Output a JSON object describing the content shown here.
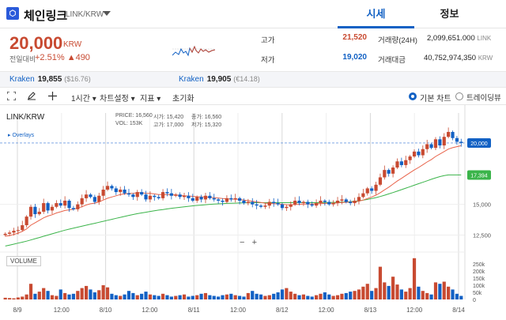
{
  "header": {
    "logo_glyph": "⬡",
    "coin_name": "체인링크",
    "pair": "LINK/KRW",
    "tab_quote": "시세",
    "tab_info": "정보"
  },
  "price": {
    "current": "20,000",
    "currency": "KRW",
    "change_label": "전일대비",
    "change_pct": "+2.51%",
    "change_abs": "▲490",
    "high_label": "고가",
    "high": "21,520",
    "low_label": "저가",
    "low": "19,020",
    "vol24_label": "거래량(24H)",
    "vol24": "2,099,651.000",
    "vol24_unit": "LINK",
    "amt_label": "거래대금",
    "amt": "40,752,974,350",
    "amt_unit": "KRW"
  },
  "exchanges": [
    {
      "name": "Kraken",
      "value": "19,855",
      "usd": "($16.76)"
    },
    {
      "name": "Kraken",
      "value": "19,905",
      "usd": "(€14.18)"
    }
  ],
  "toolbar": {
    "interval": "1시간",
    "chart_settings": "차트설정",
    "indicators": "지표",
    "reset": "초기화",
    "basic_chart": "기본 차트",
    "tradingview": "트레이딩뷰"
  },
  "ohlc": {
    "price_lbl": "PRICE:",
    "price": "16,560",
    "open_lbl": "시가:",
    "open": "15,420",
    "close_lbl": "종가:",
    "close": "16,560",
    "vol_lbl": "VOL:",
    "vol": "153K",
    "high_lbl": "고가:",
    "high": "17,000",
    "low_lbl": "저가:",
    "low": "15,320"
  },
  "chart_labels": {
    "pair": "LINK/KRW",
    "overlays": "Overlays",
    "volume": "VOLUME",
    "zoom_minus": "−",
    "zoom_plus": "+"
  },
  "colors": {
    "up": "#c84a31",
    "down": "#1261c4",
    "ma_short": "#e8634a",
    "ma_long": "#3bb44a"
  },
  "chart_data": {
    "type": "candlestick",
    "x_ticks": [
      "8/9",
      "12:00",
      "8/10",
      "12:00",
      "8/11",
      "12:00",
      "8/12",
      "12:00",
      "8/13",
      "12:00",
      "8/14"
    ],
    "y_ticks": [
      "20,000",
      "17,394",
      "15,000",
      "12,500"
    ],
    "ylim": [
      11500,
      21800
    ],
    "price_marker": "20,000",
    "ma_marker": "17,394",
    "vol_ticks": [
      "250k",
      "200k",
      "150k",
      "100k",
      "50k",
      "0"
    ],
    "closes": [
      12600,
      12700,
      12850,
      12900,
      13300,
      14000,
      14800,
      14200,
      14400,
      15100,
      14500,
      14800,
      15100,
      14900,
      15300,
      14700,
      14600,
      15000,
      15500,
      15800,
      15600,
      15200,
      15700,
      16200,
      16500,
      16300,
      16000,
      16200,
      15900,
      15800,
      15600,
      16000,
      15800,
      15400,
      15700,
      15600,
      15500,
      16000,
      15900,
      15700,
      15800,
      15600,
      15700,
      15500,
      15300,
      15600,
      15400,
      15700,
      15500,
      15400,
      15300,
      15200,
      15500,
      15400,
      15500,
      15300,
      15100,
      15200,
      15000,
      14900,
      14800,
      14900,
      15200,
      15100,
      15000,
      14700,
      14800,
      15000,
      15300,
      15100,
      15200,
      15000,
      14900,
      15100,
      15300,
      15200,
      15000,
      15100,
      15300,
      15400,
      15200,
      15100,
      15300,
      15600,
      15900,
      16300,
      16100,
      16600,
      17200,
      17800,
      17500,
      18000,
      18500,
      18200,
      18600,
      18900,
      19300,
      19000,
      19500,
      19900,
      19600,
      20300,
      19800,
      20500,
      20900,
      20400,
      20100,
      20000
    ],
    "ma_short": [
      12400,
      12450,
      12550,
      12650,
      12800,
      13000,
      13300,
      13500,
      13700,
      13900,
      14050,
      14150,
      14300,
      14400,
      14500,
      14550,
      14600,
      14700,
      14800,
      14950,
      15050,
      15100,
      15200,
      15350,
      15500,
      15600,
      15700,
      15800,
      15850,
      15900,
      15900,
      15950,
      15950,
      15900,
      15900,
      15850,
      15800,
      15800,
      15800,
      15780,
      15760,
      15720,
      15700,
      15680,
      15650,
      15620,
      15600,
      15600,
      15580,
      15550,
      15520,
      15480,
      15450,
      15430,
      15420,
      15400,
      15350,
      15300,
      15250,
      15200,
      15150,
      15100,
      15080,
      15060,
      15040,
      15000,
      14970,
      14960,
      14980,
      15000,
      15020,
      15030,
      15030,
      15040,
      15060,
      15080,
      15090,
      15100,
      15120,
      15150,
      15170,
      15180,
      15200,
      15260,
      15350,
      15480,
      15600,
      15750,
      15950,
      16180,
      16400,
      16650,
      16900,
      17120,
      17350,
      17580,
      17800,
      18000,
      18220,
      18450,
      18650,
      18900,
      19100,
      19300,
      19500,
      19620,
      19700,
      19780
    ],
    "ma_long": [
      11600,
      11680,
      11760,
      11840,
      11920,
      12000,
      12100,
      12200,
      12300,
      12400,
      12500,
      12600,
      12700,
      12800,
      12900,
      12980,
      13060,
      13140,
      13220,
      13300,
      13380,
      13460,
      13540,
      13620,
      13700,
      13780,
      13860,
      13940,
      14020,
      14100,
      14170,
      14240,
      14300,
      14360,
      14420,
      14480,
      14530,
      14580,
      14630,
      14680,
      14720,
      14760,
      14800,
      14840,
      14880,
      14910,
      14940,
      14970,
      15000,
      15020,
      15040,
      15060,
      15080,
      15090,
      15100,
      15110,
      15120,
      15130,
      15135,
      15140,
      15140,
      15140,
      15140,
      15140,
      15140,
      15140,
      15140,
      15140,
      15140,
      15140,
      15140,
      15140,
      15140,
      15140,
      15140,
      15145,
      15150,
      15160,
      15170,
      15180,
      15200,
      15220,
      15250,
      15290,
      15340,
      15400,
      15470,
      15550,
      15640,
      15740,
      15850,
      15960,
      16080,
      16200,
      16320,
      16440,
      16560,
      16680,
      16800,
      16920,
      17040,
      17160,
      17260,
      17340,
      17394,
      17394,
      17394,
      17394
    ],
    "volumes": [
      12,
      10,
      8,
      14,
      20,
      35,
      110,
      40,
      55,
      80,
      60,
      30,
      25,
      70,
      45,
      35,
      40,
      60,
      80,
      95,
      70,
      50,
      65,
      100,
      85,
      40,
      30,
      25,
      35,
      60,
      45,
      30,
      40,
      55,
      35,
      30,
      25,
      40,
      30,
      20,
      25,
      30,
      35,
      20,
      25,
      30,
      40,
      45,
      30,
      25,
      20,
      30,
      35,
      40,
      30,
      25,
      20,
      45,
      60,
      40,
      35,
      25,
      30,
      40,
      50,
      70,
      80,
      55,
      40,
      30,
      35,
      25,
      20,
      30,
      40,
      50,
      35,
      25,
      30,
      40,
      45,
      55,
      60,
      70,
      90,
      110,
      60,
      80,
      230,
      120,
      95,
      160,
      105,
      70,
      55,
      80,
      290,
      90,
      60,
      45,
      35,
      120,
      110,
      125,
      90,
      70,
      40,
      25
    ]
  }
}
